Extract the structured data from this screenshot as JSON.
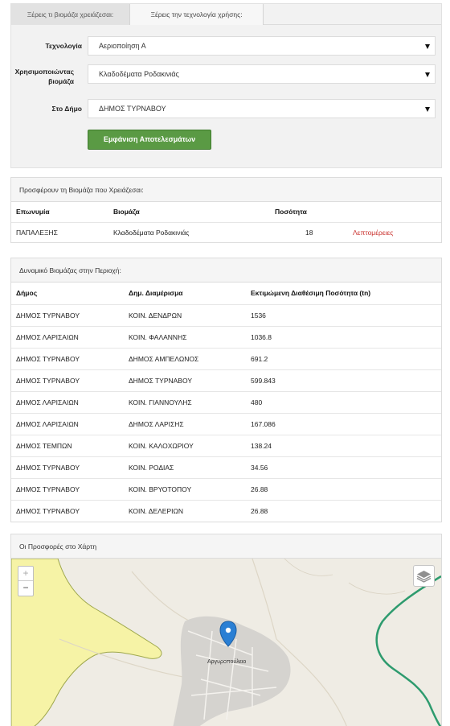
{
  "tabs": [
    "Ξέρεις τι βιομάζα χρειάζεσαι:",
    "Ξέρεις την τεχνολογία χρήσης:"
  ],
  "form": {
    "tech_label": "Τεχνολογία",
    "tech_value": "Αεριοποίηση Α",
    "biomass_label": "Χρησιμοποιώντας βιομάζα",
    "biomass_value": "Κλαδοδέματα Ροδακινιάς",
    "municipality_label": "Στο Δήμο",
    "municipality_value": "ΔΗΜΟΣ ΤΥΡΝΑΒΟΥ",
    "submit_label": "Εμφάνιση Αποτελεσμάτων"
  },
  "offers": {
    "title": "Προσφέρουν τη Βιομάζα που Χρειάζεσαι:",
    "headers": [
      "Επωνυμία",
      "Βιομάζα",
      "Ποσότητα"
    ],
    "rows": [
      {
        "name": "ΠΑΠΑΛΕΞΗΣ",
        "biomass": "Κλαδοδέματα Ροδακινιάς",
        "qty": "18",
        "link": "Λεπτομέρειες"
      }
    ]
  },
  "biomass": {
    "title": "Δυναμικό Βιομάζας στην Περιοχή:",
    "headers": [
      "Δήμος",
      "Δημ. Διαμέρισμα",
      "Εκτιμώμενη Διαθέσιμη Ποσότητα (tn)"
    ],
    "rows": [
      [
        "ΔΗΜΟΣ ΤΥΡΝΑΒΟΥ",
        "ΚΟΙΝ. ΔΕΝΔΡΩΝ",
        "1536"
      ],
      [
        "ΔΗΜΟΣ ΛΑΡΙΣΑΙΩΝ",
        "ΚΟΙΝ. ΦΑΛΑΝΝΗΣ",
        "1036.8"
      ],
      [
        "ΔΗΜΟΣ ΤΥΡΝΑΒΟΥ",
        "ΔΗΜΟΣ ΑΜΠΕΛΩΝΟΣ",
        "691.2"
      ],
      [
        "ΔΗΜΟΣ ΤΥΡΝΑΒΟΥ",
        "ΔΗΜΟΣ ΤΥΡΝΑΒΟΥ",
        "599.843"
      ],
      [
        "ΔΗΜΟΣ ΛΑΡΙΣΑΙΩΝ",
        "ΚΟΙΝ. ΓΙΑΝΝΟΥΛΗΣ",
        "480"
      ],
      [
        "ΔΗΜΟΣ ΛΑΡΙΣΑΙΩΝ",
        "ΔΗΜΟΣ ΛΑΡΙΣΗΣ",
        "167.086"
      ],
      [
        "ΔΗΜΟΣ ΤΕΜΠΩΝ",
        "ΚΟΙΝ. ΚΑΛΟΧΩΡΙΟΥ",
        "138.24"
      ],
      [
        "ΔΗΜΟΣ ΤΥΡΝΑΒΟΥ",
        "ΚΟΙΝ. ΡΟΔΙΑΣ",
        "34.56"
      ],
      [
        "ΔΗΜΟΣ ΤΥΡΝΑΒΟΥ",
        "ΚΟΙΝ. ΒΡΥΟΤΟΠΟΥ",
        "26.88"
      ],
      [
        "ΔΗΜΟΣ ΤΥΡΝΑΒΟΥ",
        "ΚΟΙΝ. ΔΕΛΕΡΙΩΝ",
        "26.88"
      ]
    ]
  },
  "map": {
    "title": "Οι Προσφορές στο Χάρτη",
    "zoom_in": "+",
    "zoom_out": "−",
    "town_label": "Αργυροπούλειο",
    "marker_color": "#2a7fd4",
    "icons": [
      "marker-icon",
      "layers-icon"
    ]
  },
  "colors": {
    "submit_bg": "#5a9a44",
    "link": "#c9302c",
    "water": "#f7f4a4",
    "border_green": "#2e9b6e"
  }
}
